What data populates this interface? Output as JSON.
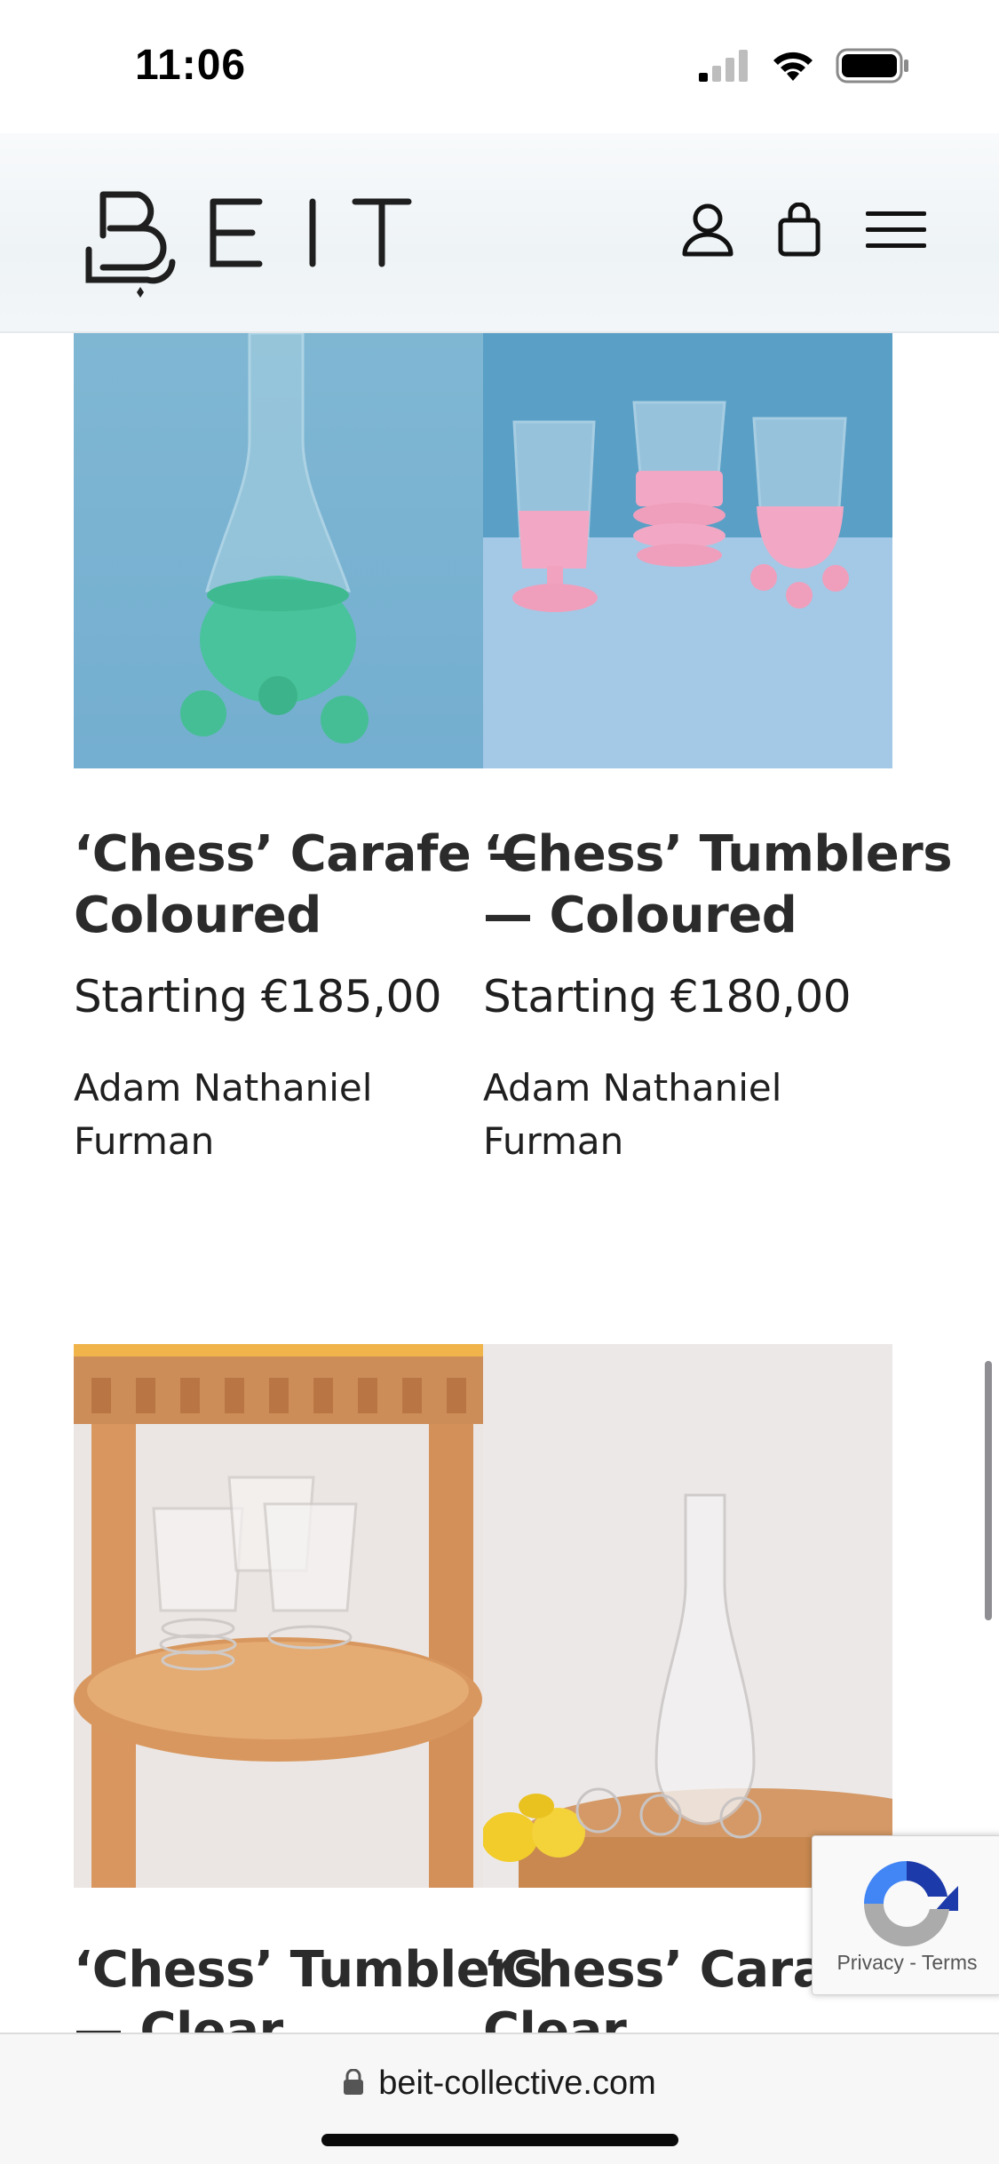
{
  "status_bar": {
    "time": "11:06",
    "signal_icon": "cellular-signal-icon",
    "wifi_icon": "wifi-icon",
    "battery_icon": "battery-icon"
  },
  "header": {
    "logo_text": "BEIT",
    "account_icon": "user-icon",
    "cart_icon": "shopping-bag-icon",
    "menu_icon": "hamburger-menu-icon"
  },
  "products": [
    {
      "title_line1": "‘Chess’ Carafe —",
      "title_line2": "Coloured",
      "price": "Starting €185,00",
      "designer_line1": "Adam Nathaniel",
      "designer_line2": "Furman",
      "image": "green-chess-carafe-photo"
    },
    {
      "title_line1": "‘Chess’ Tumblers",
      "title_line2": "— Coloured",
      "price": "Starting €180,00",
      "designer_line1": "Adam Nathaniel",
      "designer_line2": "Furman",
      "image": "pink-chess-tumblers-photo"
    },
    {
      "title_line1": "‘Chess’ Tumblers",
      "title_line2": "— Clear",
      "image": "clear-chess-tumblers-photo"
    },
    {
      "title_line1": "‘Chess’ Carafe",
      "title_line2": "Clear",
      "image": "clear-chess-carafe-photo"
    }
  ],
  "recaptcha": {
    "links": "Privacy - Terms",
    "icon": "recaptcha-icon"
  },
  "browser": {
    "url": "beit-collective.com",
    "lock_icon": "lock-icon"
  }
}
